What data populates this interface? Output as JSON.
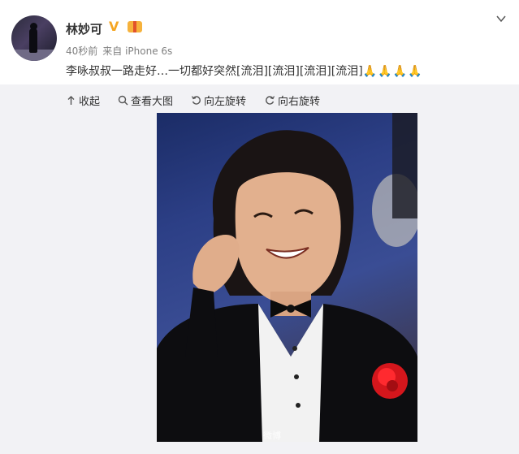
{
  "post": {
    "username": "林妙可",
    "verified_badge": "V",
    "time": "40秒前",
    "source": "来自 iPhone 6s",
    "text_main": "李咏叔叔一路走好…一切都好突然[流泪][流泪][流泪][流泪]",
    "text_emojis": "🙏🙏🙏🙏"
  },
  "toolbar": {
    "collapse": "收起",
    "view_large": "查看大图",
    "rotate_left": "向左旋转",
    "rotate_right": "向右旋转"
  },
  "photo": {
    "watermark": "微博"
  },
  "colors": {
    "username": "#333333",
    "verified": "#f5a623",
    "meta": "#808080",
    "toolbar_bg": "#f2f2f5"
  },
  "icons": [
    "chevron-down-icon",
    "collapse-up-icon",
    "search-icon",
    "rotate-left-icon",
    "rotate-right-icon",
    "verified-v-icon",
    "gift-badge-icon"
  ]
}
